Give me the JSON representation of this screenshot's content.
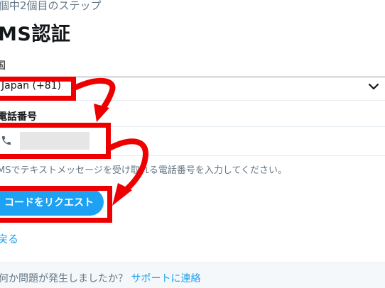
{
  "step_text": "個中2個目のステップ",
  "title": "MS認証",
  "country": {
    "label": "国",
    "value": "Japan (+81)",
    "chevron_icon": "chevron-down-icon"
  },
  "phone": {
    "label": "電話番号",
    "icon": "phone-icon",
    "value": ""
  },
  "hint": "MSでテキストメッセージを受け取れる電話番号を入力してください。",
  "request_button": "コードをリクエスト",
  "back_link": "戻る",
  "footer": {
    "question": "何か問題が発生しましたか？",
    "link": "サポートに連絡"
  },
  "colors": {
    "accent": "#1da1f2",
    "annotation": "#ee0000",
    "muted_text": "#657786"
  }
}
